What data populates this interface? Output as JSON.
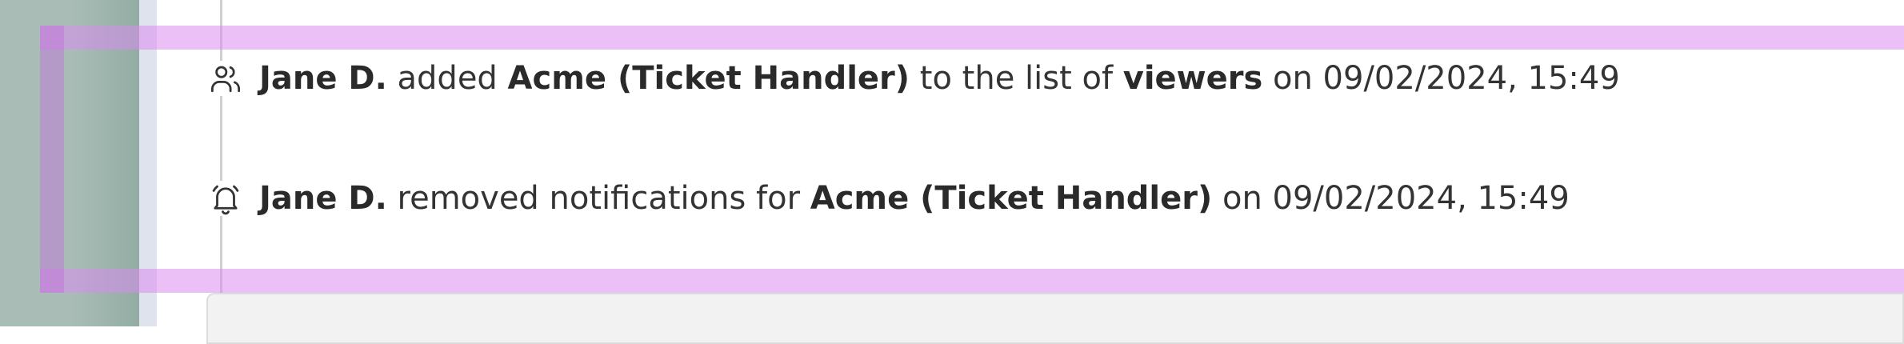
{
  "timeline": {
    "entries": [
      {
        "icon": "users-icon",
        "actor": "Jane D.",
        "verb": " added ",
        "target": "Acme (Ticket Handler)",
        "mid": " to the list of ",
        "role": "viewers",
        "tail": " on 09/02/2024, 15:49"
      },
      {
        "icon": "bell-off-icon",
        "actor": "Jane D.",
        "verb": " removed notifications for ",
        "target": "Acme (Ticket Handler)",
        "tail": " on 09/02/2024, 15:49"
      }
    ]
  },
  "colors": {
    "highlight": "#d88cee",
    "sidebar": "#a9bdb6",
    "text": "#333333"
  }
}
